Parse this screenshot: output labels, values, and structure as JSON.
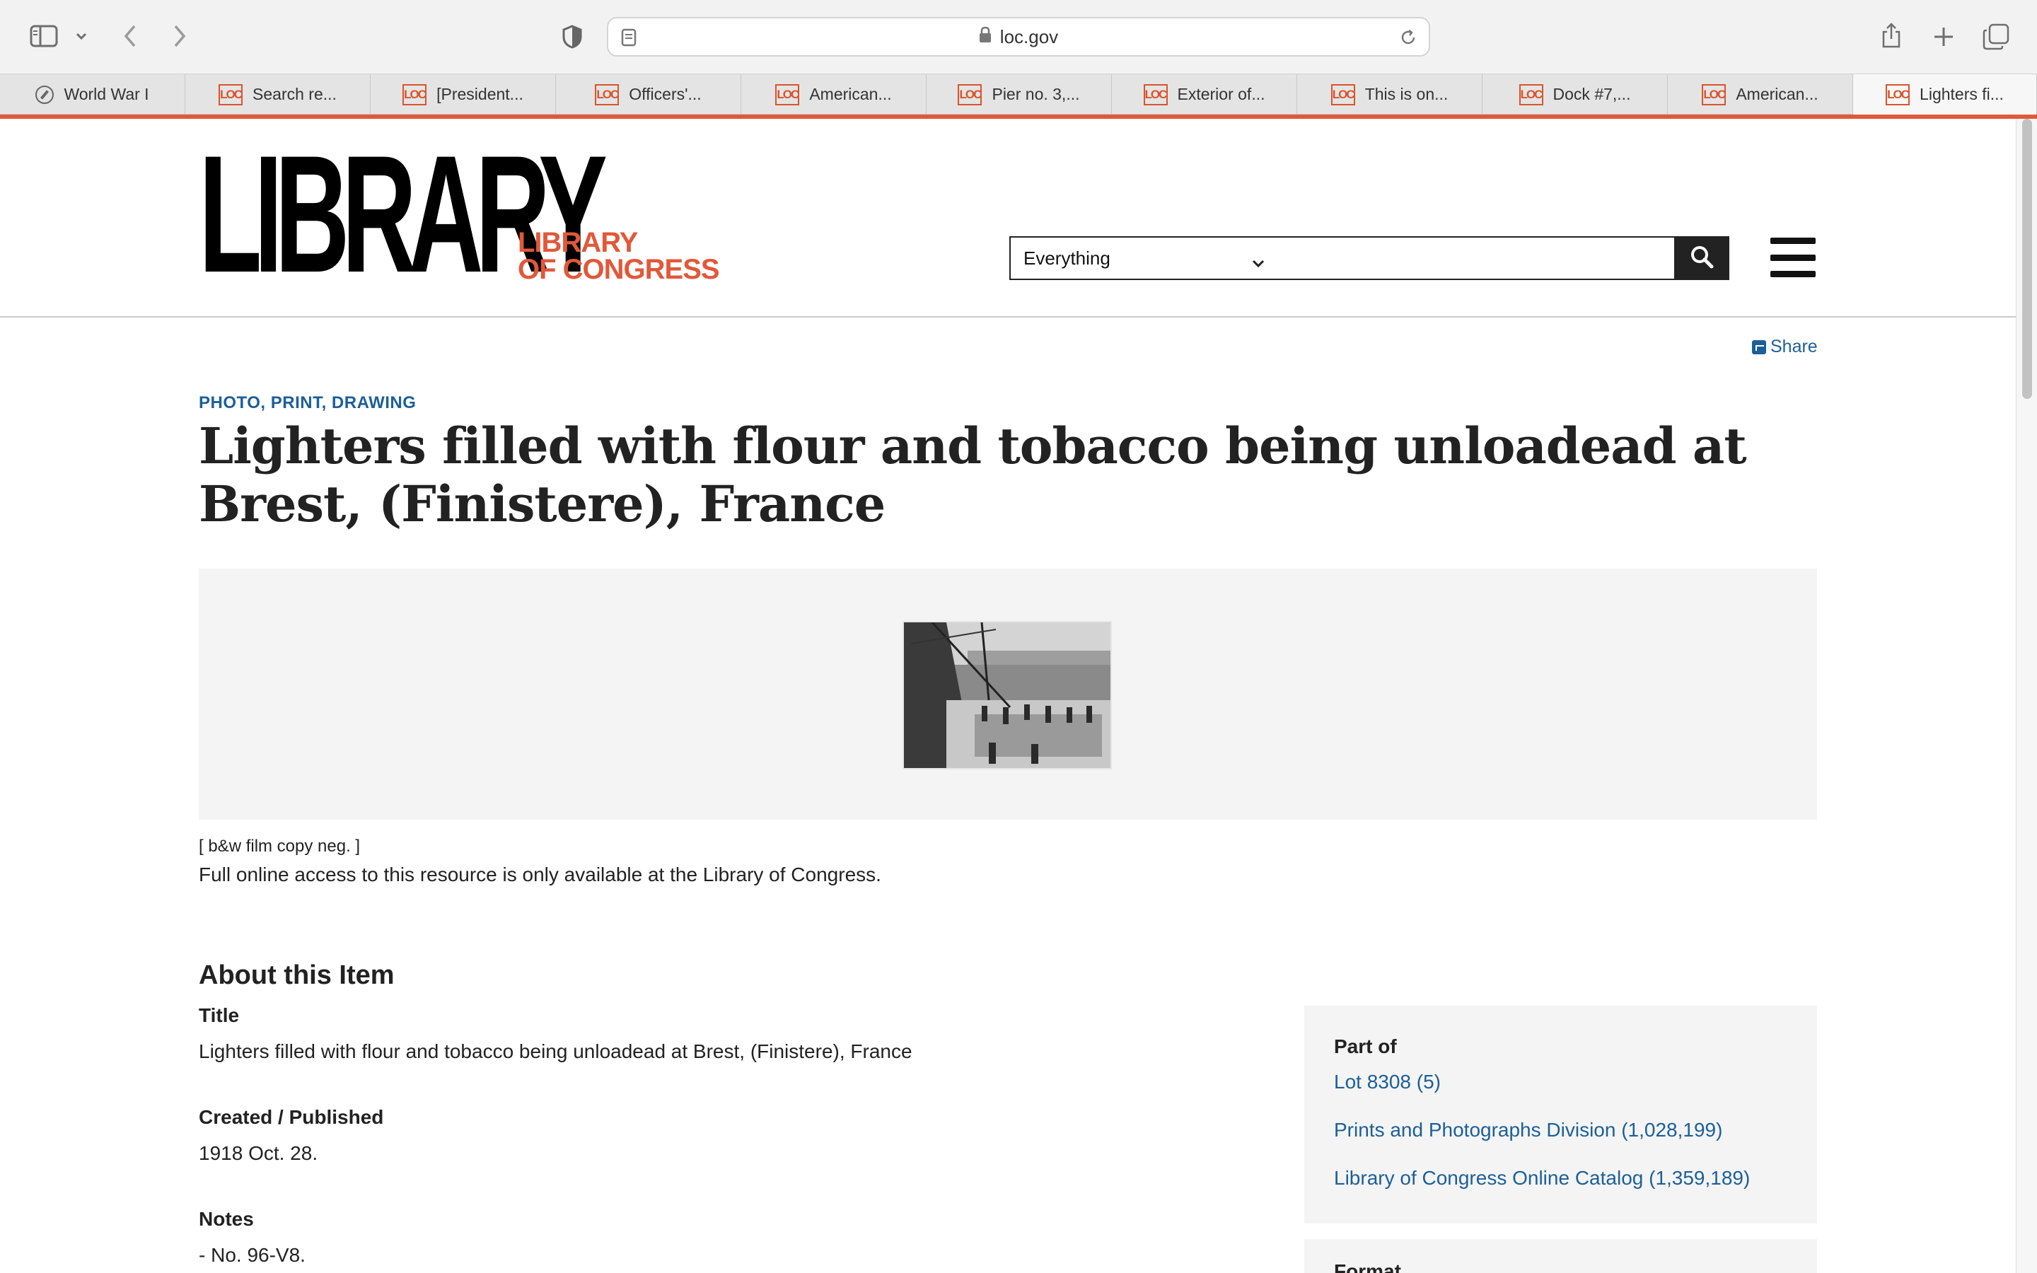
{
  "browser": {
    "url": "loc.gov",
    "tabs": [
      {
        "label": "World War I",
        "icon": "compass-icon"
      },
      {
        "label": "Search re...",
        "icon": "loc-favicon"
      },
      {
        "label": "[President...",
        "icon": "loc-favicon"
      },
      {
        "label": "Officers'...",
        "icon": "loc-favicon"
      },
      {
        "label": "American...",
        "icon": "loc-favicon"
      },
      {
        "label": "Pier no. 3,...",
        "icon": "loc-favicon"
      },
      {
        "label": "Exterior of...",
        "icon": "loc-favicon"
      },
      {
        "label": "This is on...",
        "icon": "loc-favicon"
      },
      {
        "label": "Dock #7,...",
        "icon": "loc-favicon"
      },
      {
        "label": "American...",
        "icon": "loc-favicon"
      },
      {
        "label": "Lighters fi...",
        "icon": "loc-favicon",
        "active": true
      }
    ],
    "favicon_text": "LOC"
  },
  "header": {
    "logo_main": "LIBRARY",
    "logo_sub_line1": "LIBRARY",
    "logo_sub_line2": "OF CONGRESS",
    "search_scope": "Everything",
    "search_value": ""
  },
  "share_label": "Share",
  "item": {
    "kicker": "PHOTO, PRINT, DRAWING",
    "title": "Lighters filled with flour and tobacco being unloadead at Brest, (Finistere), France",
    "caption_small": "[ b&w film copy neg. ]",
    "access_note": "Full online access to this resource is only available at the Library of Congress."
  },
  "about": {
    "heading": "About this Item",
    "fields": [
      {
        "label": "Title",
        "value": "Lighters filled with flour and tobacco being unloadead at Brest, (Finistere), France"
      },
      {
        "label": "Created / Published",
        "value": "1918 Oct. 28."
      },
      {
        "label": "Notes",
        "value": "-  No. 96-V8."
      }
    ]
  },
  "part_of": {
    "heading": "Part of",
    "links": [
      "Lot 8308 (5)",
      "Prints and Photographs Division (1,028,199)",
      "Library of Congress Online Catalog (1,359,189)"
    ]
  },
  "format_heading": "Format",
  "colors": {
    "accent": "#e1583a",
    "link": "#1c5f98",
    "text": "#222222"
  }
}
